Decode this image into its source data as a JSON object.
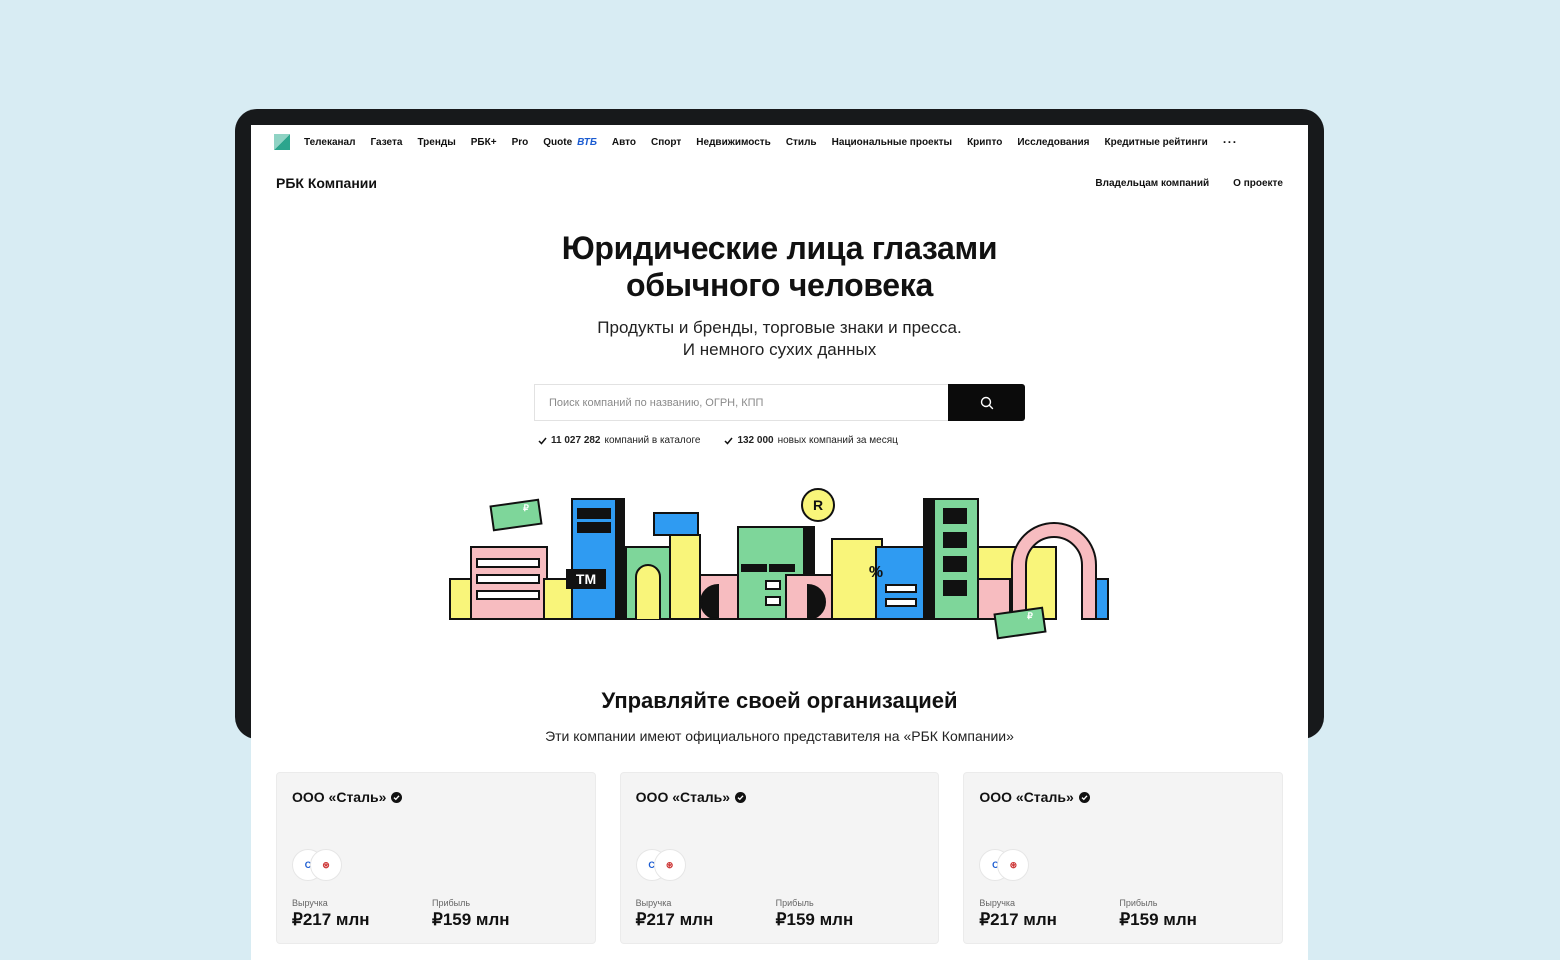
{
  "colors": {
    "background": "#d8ecf3",
    "device": "#17191b",
    "accent_blue": "#1a5bd1",
    "green": "#7ed69a",
    "blue": "#2f9bf2",
    "pink": "#f7bcc0",
    "yellow": "#f9f57a"
  },
  "topnav": {
    "logo_icon": "rbc-logo-icon",
    "items": [
      "Телеканал",
      "Газета",
      "Тренды",
      "РБК+",
      "Pro",
      "Quote",
      "Авто",
      "Спорт",
      "Недвижимость",
      "Стиль",
      "Национальные проекты",
      "Крипто",
      "Исследования",
      "Кредитные рейтинги"
    ],
    "vtb": "ВТБ",
    "more": "···"
  },
  "brandbar": {
    "brand": "РБК Компании",
    "links": [
      "Владельцам компаний",
      "О проекте"
    ]
  },
  "hero": {
    "title_line1": "Юридические лица глазами",
    "title_line2": "обычного человека",
    "subtitle_line1": "Продукты и бренды, торговые знаки и пресса.",
    "subtitle_line2": "И немного сухих данных"
  },
  "search": {
    "placeholder": "Поиск компаний по названию, ОГРН, КПП",
    "button_icon": "search-icon"
  },
  "stats": [
    {
      "value": "11 027 282",
      "text": "компаний в каталоге"
    },
    {
      "value": "132 000",
      "text": "новых компаний за месяц"
    }
  ],
  "illustration_labels": {
    "tm": "TM",
    "percent": "%",
    "registered": "R",
    "ruble": "₽"
  },
  "section": {
    "title": "Управляйте своей организацией",
    "subtitle": "Эти компании имеют официального представителя на «РБК Компании»"
  },
  "cards": [
    {
      "name": "ООО «Сталь»",
      "revenue_label": "Выручка",
      "revenue": "₽217 млн",
      "profit_label": "Прибыль",
      "profit": "₽159 млн"
    },
    {
      "name": "ООО «Сталь»",
      "revenue_label": "Выручка",
      "revenue": "₽217 млн",
      "profit_label": "Прибыль",
      "profit": "₽159 млн"
    },
    {
      "name": "ООО «Сталь»",
      "revenue_label": "Выручка",
      "revenue": "₽217 млн",
      "profit_label": "Прибыль",
      "profit": "₽159 млн"
    }
  ]
}
